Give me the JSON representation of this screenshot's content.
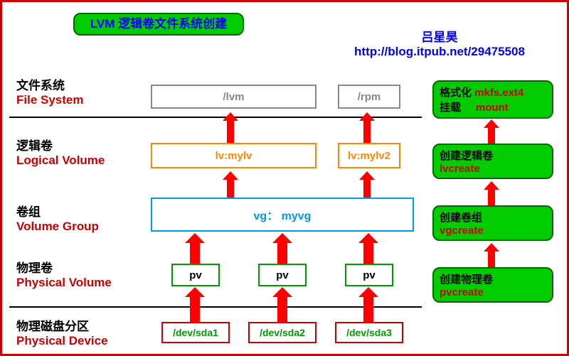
{
  "title": "LVM 逻辑卷文件系统创建",
  "attribution": {
    "author": "吕星昊",
    "url": "http://blog.itpub.net/29475508"
  },
  "layers": {
    "fs": {
      "cn": "文件系统",
      "en": "File System",
      "boxes": {
        "lvm": "/lvm",
        "rpm": "/rpm"
      }
    },
    "lv": {
      "cn": "逻辑卷",
      "en": "Logical Volume",
      "boxes": {
        "mylv": "lv:mylv",
        "mylv2": "lv:mylv2"
      }
    },
    "vg": {
      "cn": "卷组",
      "en": "Volume Group",
      "boxes": {
        "myvg": "vg： myvg"
      }
    },
    "pv": {
      "cn": "物理卷",
      "en": "Physical Volume",
      "boxes": {
        "pv1": "pv",
        "pv2": "pv",
        "pv3": "pv"
      }
    },
    "pd": {
      "cn": "物理磁盘分区",
      "en": "Physical Device",
      "boxes": {
        "sda1": "/dev/sda1",
        "sda2": "/dev/sda2",
        "sda3": "/dev/sda3"
      }
    }
  },
  "sidebar": {
    "mkfs": {
      "cn1": "格式化",
      "cmd1": "mkfs.ext4",
      "cn2": "挂载",
      "cmd2": "mount"
    },
    "lvcreate": {
      "cn": "创建逻辑卷",
      "cmd": "lvcreate"
    },
    "vgcreate": {
      "cn": "创建卷组",
      "cmd": "vgcreate"
    },
    "pvcreate": {
      "cn": "创建物理卷",
      "cmd": "pvcreate"
    }
  }
}
